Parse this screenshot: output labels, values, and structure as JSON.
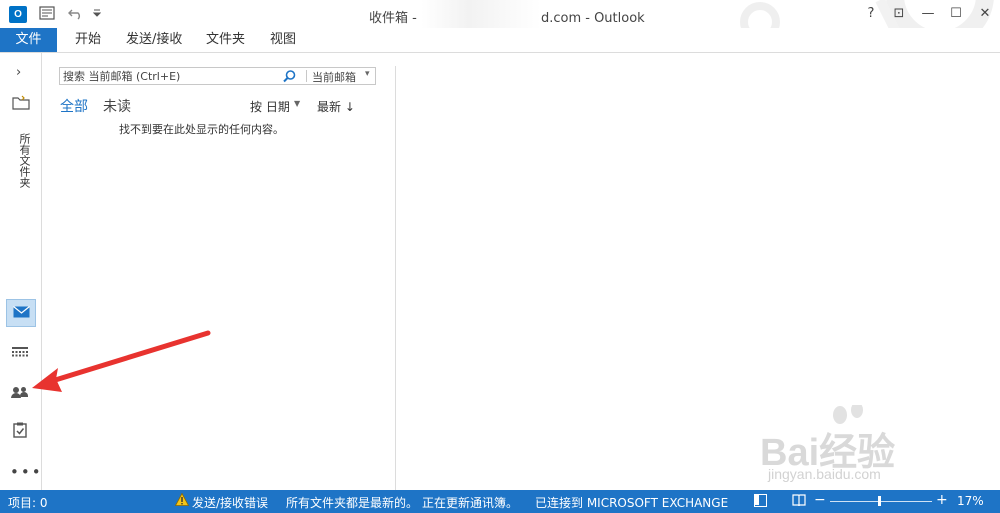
{
  "app": {
    "icon_text": "O",
    "window_title": "收件箱 - ",
    "window_title_suffix": "d.com - Outlook"
  },
  "window_controls": {
    "help": "?",
    "restore_ribbon": "⊡",
    "minimize": "—",
    "maximize": "☐",
    "close": "✕"
  },
  "ribbon": {
    "file_tab": "文件",
    "tabs": [
      "开始",
      "发送/接收",
      "文件夹",
      "视图"
    ]
  },
  "left_nav": {
    "expand": "›",
    "all_folders": "所有文件夹",
    "more": "•••"
  },
  "search": {
    "placeholder": "搜索 当前邮箱 (Ctrl+E)",
    "scope": "当前邮箱"
  },
  "filters": {
    "all": "全部",
    "unread": "未读"
  },
  "sort": {
    "by": "按 日期",
    "order": "最新 ↓"
  },
  "message_list": {
    "empty_text": "找不到要在此处显示的任何内容。"
  },
  "status_bar": {
    "items": "项目: 0",
    "send_receive_error": "发送/接收错误",
    "folders_uptodate": "所有文件夹都是最新的。",
    "updating_addressbook": "正在更新通讯簿。",
    "connected": "已连接到 MICROSOFT EXCHANGE",
    "zoom_minus": "−",
    "zoom_plus": "+",
    "zoom": "17%"
  },
  "watermark": {
    "brand": "Bai经验",
    "url": "jingyan.baidu.com"
  },
  "colors": {
    "accent": "#1e74c6",
    "annotation": "#e8332f"
  }
}
